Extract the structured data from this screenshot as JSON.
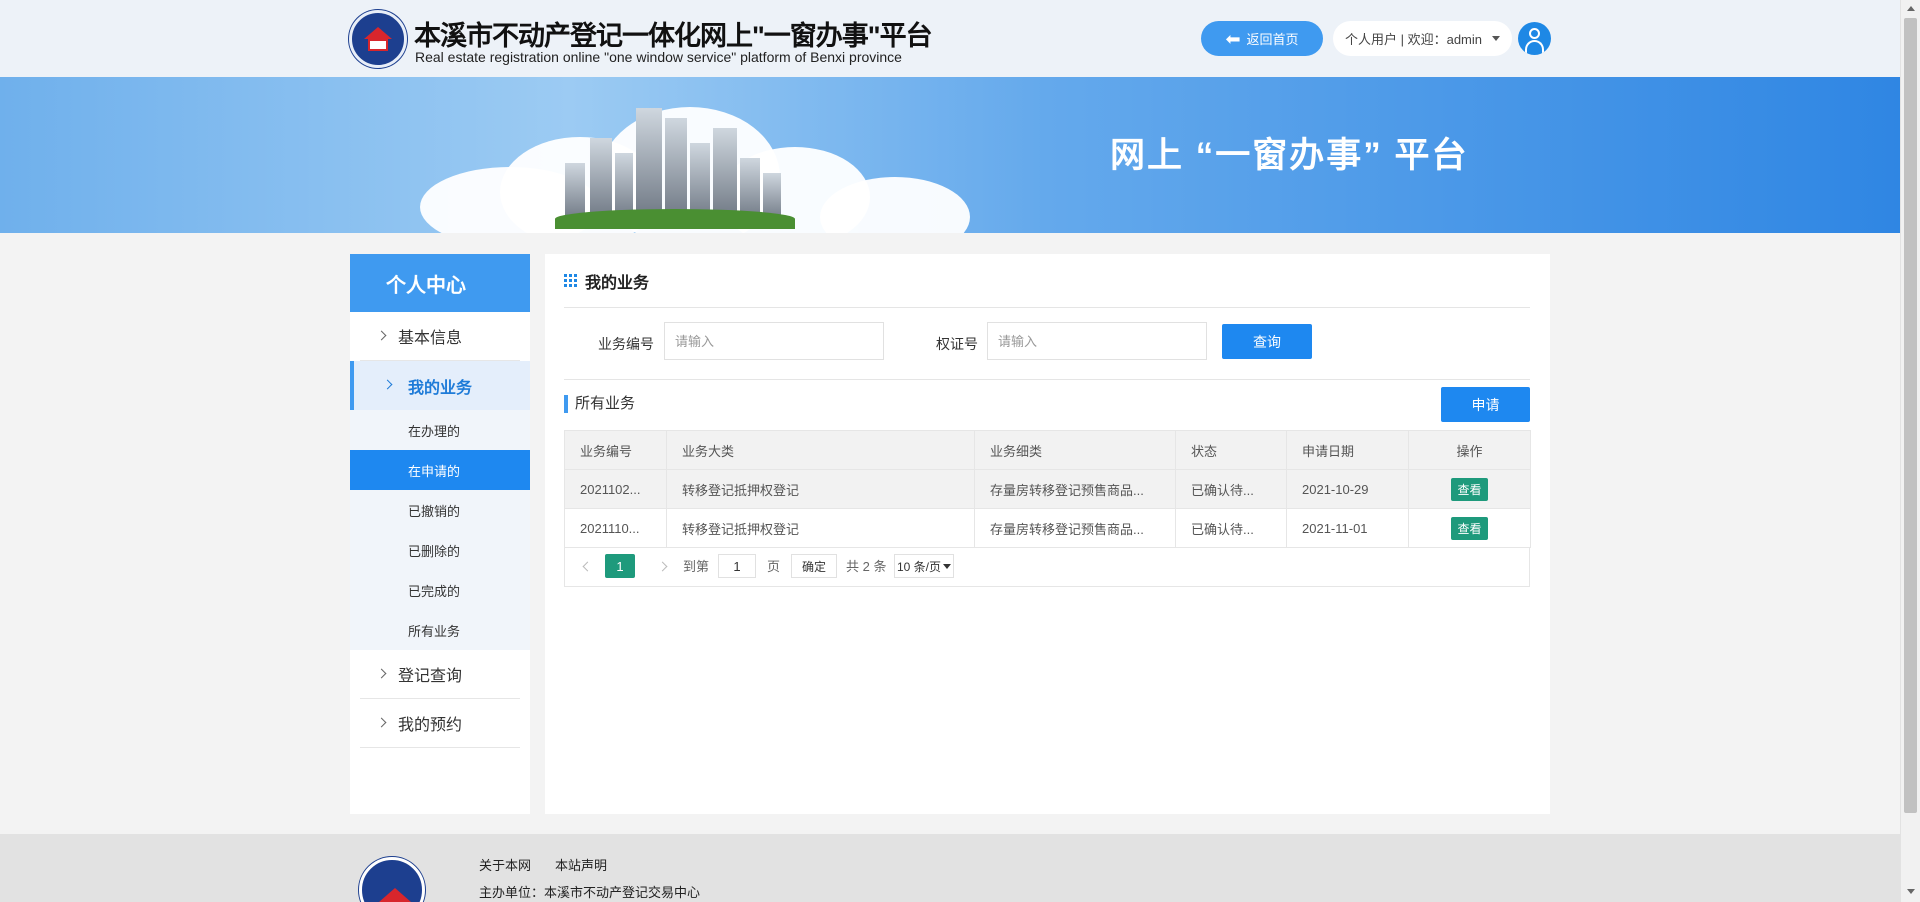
{
  "header": {
    "title": "本溪市不动产登记一体化网上\"一窗办事\"平台",
    "subtitle": "Real estate registration online \"one window service\" platform of Benxi province",
    "home_button": "返回首页",
    "user_text": "个人用户 | 欢迎：admin"
  },
  "banner": {
    "title": "网上 “一窗办事” 平台"
  },
  "sidebar": {
    "heading": "个人中心",
    "items": [
      {
        "label": "基本信息"
      },
      {
        "label": "我的业务"
      },
      {
        "label": "登记查询"
      },
      {
        "label": "我的预约"
      }
    ],
    "sub_items": [
      {
        "label": "在办理的"
      },
      {
        "label": "在申请的"
      },
      {
        "label": "已撤销的"
      },
      {
        "label": "已删除的"
      },
      {
        "label": "已完成的"
      },
      {
        "label": "所有业务"
      }
    ]
  },
  "main": {
    "title": "我的业务",
    "search": {
      "business_no_label": "业务编号",
      "business_no_placeholder": "请输入",
      "cert_no_label": "权证号",
      "cert_no_placeholder": "请输入",
      "query_button": "查询"
    },
    "section_title": "所有业务",
    "apply_button": "申请",
    "table": {
      "headers": [
        "业务编号",
        "业务大类",
        "业务细类",
        "状态",
        "申请日期",
        "操作"
      ],
      "rows": [
        {
          "no": "2021102...",
          "category": "转移登记抵押权登记",
          "subcategory": "存量房转移登记预售商品...",
          "status": "已确认待...",
          "date": "2021-10-29",
          "action": "查看"
        },
        {
          "no": "2021110...",
          "category": "转移登记抵押权登记",
          "subcategory": "存量房转移登记预售商品...",
          "status": "已确认待...",
          "date": "2021-11-01",
          "action": "查看"
        }
      ]
    },
    "pager": {
      "current": "1",
      "goto_label": "到第",
      "goto_value": "1",
      "page_label": "页",
      "confirm": "确定",
      "total": "共 2 条",
      "page_size": "10 条/页"
    }
  },
  "footer": {
    "links": [
      "关于本网",
      "本站声明"
    ],
    "organizer": "主办单位：本溪市不动产登记交易中心"
  },
  "colors": {
    "primary": "#1e88f0",
    "accent_green": "#1e9a7c",
    "sidebar_head": "#3f9af0"
  }
}
